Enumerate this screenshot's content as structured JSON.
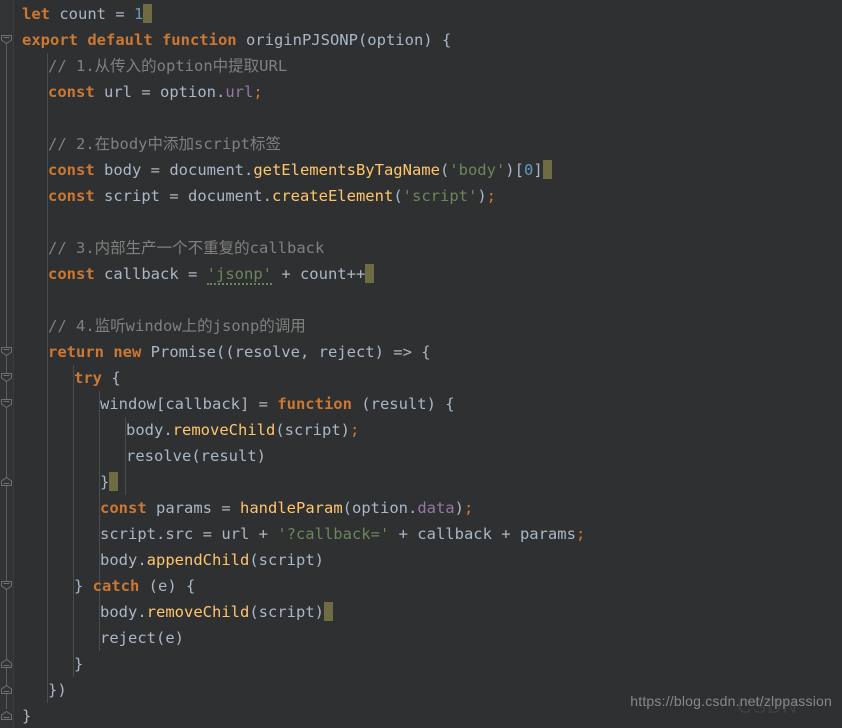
{
  "editor": {
    "background_color": "#2f3031",
    "gutter_color": "#313335",
    "default_text_color": "#a9b7c6",
    "line_height_px": 26,
    "font_size_px": 15.5
  },
  "colors": {
    "keyword": "#cc7832",
    "function_call": "#ffc66d",
    "string": "#6a8759",
    "number": "#6897bb",
    "comment": "#808080",
    "field": "#9876aa",
    "plain": "#a9b7c6",
    "caret_block": "#6f6b42",
    "indent_guide": "#4a4d4f"
  },
  "lines": [
    {
      "n": 1,
      "indent": 0,
      "tokens": [
        {
          "t": "let",
          "c": "kw"
        },
        {
          "t": " count = ",
          "c": "plain"
        },
        {
          "t": "1",
          "c": "num"
        },
        {
          "t": "",
          "c": "caret"
        }
      ]
    },
    {
      "n": 2,
      "indent": 0,
      "tokens": [
        {
          "t": "export default function",
          "c": "kw"
        },
        {
          "t": " originPJSONP(option) {",
          "c": "plain"
        }
      ]
    },
    {
      "n": 3,
      "indent": 1,
      "tokens": [
        {
          "t": "// 1.从传入的option中提取URL",
          "c": "cmt"
        }
      ]
    },
    {
      "n": 4,
      "indent": 1,
      "tokens": [
        {
          "t": "const",
          "c": "kw"
        },
        {
          "t": " url = option.",
          "c": "plain"
        },
        {
          "t": "url",
          "c": "fld"
        },
        {
          "t": ";",
          "c": "pun"
        }
      ]
    },
    {
      "n": 5,
      "indent": 0,
      "tokens": []
    },
    {
      "n": 6,
      "indent": 1,
      "tokens": [
        {
          "t": "// 2.在body中添加script标签",
          "c": "cmt"
        }
      ]
    },
    {
      "n": 7,
      "indent": 1,
      "tokens": [
        {
          "t": "const",
          "c": "kw"
        },
        {
          "t": " body = document.",
          "c": "plain"
        },
        {
          "t": "getElementsByTagName",
          "c": "fn"
        },
        {
          "t": "(",
          "c": "plain"
        },
        {
          "t": "'body'",
          "c": "str"
        },
        {
          "t": ")[",
          "c": "plain"
        },
        {
          "t": "0",
          "c": "num"
        },
        {
          "t": "]",
          "c": "plain"
        },
        {
          "t": "",
          "c": "caret"
        }
      ]
    },
    {
      "n": 8,
      "indent": 1,
      "tokens": [
        {
          "t": "const",
          "c": "kw"
        },
        {
          "t": " script = document.",
          "c": "plain"
        },
        {
          "t": "createElement",
          "c": "fn"
        },
        {
          "t": "(",
          "c": "plain"
        },
        {
          "t": "'script'",
          "c": "str"
        },
        {
          "t": ")",
          "c": "plain"
        },
        {
          "t": ";",
          "c": "pun"
        }
      ]
    },
    {
      "n": 9,
      "indent": 0,
      "tokens": []
    },
    {
      "n": 10,
      "indent": 1,
      "tokens": [
        {
          "t": "// 3.内部生产一个不重复的callback",
          "c": "cmt"
        }
      ]
    },
    {
      "n": 11,
      "indent": 1,
      "tokens": [
        {
          "t": "const",
          "c": "kw"
        },
        {
          "t": " callback = ",
          "c": "plain"
        },
        {
          "t": "'jsonp'",
          "c": "str typo"
        },
        {
          "t": " + count++",
          "c": "plain"
        },
        {
          "t": "",
          "c": "caret"
        }
      ]
    },
    {
      "n": 12,
      "indent": 0,
      "tokens": []
    },
    {
      "n": 13,
      "indent": 1,
      "tokens": [
        {
          "t": "// 4.监听window上的jsonp的调用",
          "c": "cmt"
        }
      ]
    },
    {
      "n": 14,
      "indent": 1,
      "tokens": [
        {
          "t": "return new",
          "c": "kw"
        },
        {
          "t": " Promise((resolve, reject) => {",
          "c": "plain"
        }
      ]
    },
    {
      "n": 15,
      "indent": 2,
      "tokens": [
        {
          "t": "try",
          "c": "kw"
        },
        {
          "t": " {",
          "c": "plain"
        }
      ]
    },
    {
      "n": 16,
      "indent": 3,
      "tokens": [
        {
          "t": "window[callback] = ",
          "c": "plain"
        },
        {
          "t": "function",
          "c": "kw"
        },
        {
          "t": " (result) {",
          "c": "plain"
        }
      ]
    },
    {
      "n": 17,
      "indent": 4,
      "tokens": [
        {
          "t": "body.",
          "c": "plain"
        },
        {
          "t": "removeChild",
          "c": "fn"
        },
        {
          "t": "(script)",
          "c": "plain"
        },
        {
          "t": ";",
          "c": "pun"
        }
      ]
    },
    {
      "n": 18,
      "indent": 4,
      "tokens": [
        {
          "t": "resolve(result)",
          "c": "plain"
        }
      ]
    },
    {
      "n": 19,
      "indent": 3,
      "tokens": [
        {
          "t": "}",
          "c": "plain"
        },
        {
          "t": "",
          "c": "caret"
        }
      ]
    },
    {
      "n": 20,
      "indent": 3,
      "tokens": [
        {
          "t": "const",
          "c": "kw"
        },
        {
          "t": " params = ",
          "c": "plain"
        },
        {
          "t": "handleParam",
          "c": "fn"
        },
        {
          "t": "(option.",
          "c": "plain"
        },
        {
          "t": "data",
          "c": "fld"
        },
        {
          "t": ")",
          "c": "plain"
        },
        {
          "t": ";",
          "c": "pun"
        }
      ]
    },
    {
      "n": 21,
      "indent": 3,
      "tokens": [
        {
          "t": "script.src = url + ",
          "c": "plain"
        },
        {
          "t": "'?callback='",
          "c": "str"
        },
        {
          "t": " + callback + params",
          "c": "plain"
        },
        {
          "t": ";",
          "c": "pun"
        }
      ]
    },
    {
      "n": 22,
      "indent": 3,
      "tokens": [
        {
          "t": "body.",
          "c": "plain"
        },
        {
          "t": "appendChild",
          "c": "fn"
        },
        {
          "t": "(script)",
          "c": "plain"
        }
      ]
    },
    {
      "n": 23,
      "indent": 2,
      "tokens": [
        {
          "t": "} ",
          "c": "plain"
        },
        {
          "t": "catch",
          "c": "kw"
        },
        {
          "t": " (e) {",
          "c": "plain"
        }
      ]
    },
    {
      "n": 24,
      "indent": 3,
      "tokens": [
        {
          "t": "body.",
          "c": "plain"
        },
        {
          "t": "removeChild",
          "c": "fn"
        },
        {
          "t": "(script)",
          "c": "plain"
        },
        {
          "t": "",
          "c": "caret"
        }
      ]
    },
    {
      "n": 25,
      "indent": 3,
      "tokens": [
        {
          "t": "reject(e)",
          "c": "plain"
        }
      ]
    },
    {
      "n": 26,
      "indent": 2,
      "tokens": [
        {
          "t": "}",
          "c": "plain"
        }
      ]
    },
    {
      "n": 27,
      "indent": 1,
      "tokens": [
        {
          "t": "})",
          "c": "plain"
        }
      ]
    },
    {
      "n": 28,
      "indent": 0,
      "tokens": [
        {
          "t": "}",
          "c": "plain"
        }
      ]
    }
  ],
  "fold_markers": [
    {
      "line": 2,
      "type": "fold-collapse-icon"
    },
    {
      "line": 14,
      "type": "fold-collapse-icon"
    },
    {
      "line": 15,
      "type": "fold-collapse-icon"
    },
    {
      "line": 16,
      "type": "fold-collapse-icon"
    },
    {
      "line": 19,
      "type": "fold-region-end-icon"
    },
    {
      "line": 23,
      "type": "fold-collapse-icon"
    },
    {
      "line": 26,
      "type": "fold-region-end-icon"
    },
    {
      "line": 27,
      "type": "fold-region-end-icon"
    },
    {
      "line": 28,
      "type": "fold-region-end-icon"
    }
  ],
  "indent_guides": [
    {
      "col": 1,
      "from_line": 3,
      "to_line": 27
    },
    {
      "col": 2,
      "from_line": 15,
      "to_line": 26
    },
    {
      "col": 3,
      "from_line": 16,
      "to_line": 25
    },
    {
      "col": 4,
      "from_line": 17,
      "to_line": 19
    }
  ],
  "watermark": {
    "url_text": "https://blog.csdn.net/zlppassion",
    "logo_text": "CSDN"
  }
}
